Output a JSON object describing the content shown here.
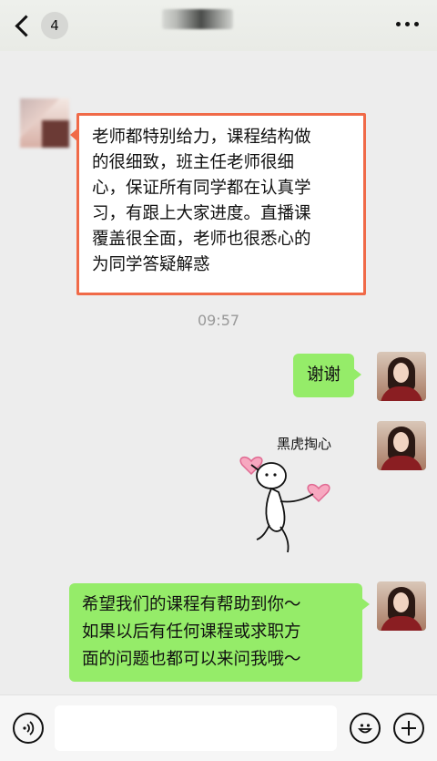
{
  "header": {
    "unread_count": "4",
    "back_icon": "chevron-left-icon",
    "more_icon": "more-dots-icon"
  },
  "messages": [
    {
      "from": "contact",
      "text": "老师都特别给力，课程结构做的很细致，班主任老师很细心，保证所有同学都在认真学习，有跟上大家进度。直播课覆盖很全面，老师也很悉心的为同学答疑解惑",
      "lines": [
        "老师都特别给力，课程结构做",
        "的很细致，班主任老师很细",
        "心，保证所有同学都在认真学",
        "习，有跟上大家进度。直播课",
        "覆盖很全面，老师也很悉心的",
        "为同学答疑解惑"
      ],
      "highlight_color": "#f06a48"
    },
    {
      "type": "time",
      "text": "09:57"
    },
    {
      "from": "me",
      "text": "谢谢"
    },
    {
      "from": "me",
      "type": "sticker",
      "caption": "黑虎掏心"
    },
    {
      "from": "me",
      "text": "希望我们的课程有帮助到你～如果以后有任何课程或求职方面的问题也都可以来问我哦～",
      "lines": [
        "希望我们的课程有帮助到你～",
        "如果以后有任何课程或求职方",
        "面的问题也都可以来问我哦～"
      ]
    }
  ],
  "footer": {
    "voice_icon": "voice-icon",
    "emoji_icon": "emoji-icon",
    "plus_icon": "plus-icon"
  },
  "colors": {
    "outgoing_bubble": "#95ec69",
    "incoming_bubble": "#ffffff",
    "background": "#ededed"
  }
}
